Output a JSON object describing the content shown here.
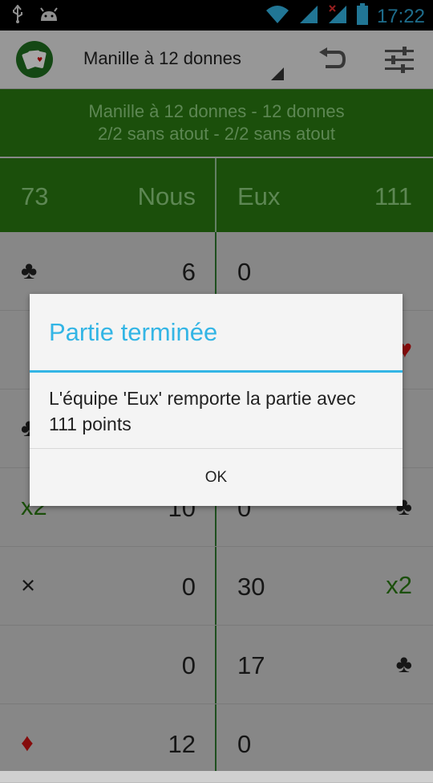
{
  "status_bar": {
    "time": "17:22"
  },
  "action_bar": {
    "game_selector": "Manille à 12 donnes"
  },
  "game_header": {
    "line1": "Manille à 12 donnes - 12 donnes",
    "line2": "2/2 sans atout - 2/2 sans atout"
  },
  "score_header": {
    "left_score": "73",
    "left_team": "Nous",
    "right_team": "Eux",
    "right_score": "111"
  },
  "rows": [
    {
      "left_symbol": "♣",
      "left_value": "6",
      "right_value": "0",
      "right_symbol": ""
    },
    {
      "left_symbol": "",
      "left_value": "",
      "right_value": "",
      "right_symbol": "♥"
    },
    {
      "left_symbol": "♣",
      "left_value": "",
      "right_value": "",
      "right_symbol": ""
    },
    {
      "left_symbol": "x2",
      "left_value": "10",
      "right_value": "0",
      "right_symbol": "♣"
    },
    {
      "left_symbol": "×",
      "left_value": "0",
      "right_value": "30",
      "right_symbol": "x2"
    },
    {
      "left_symbol": "",
      "left_value": "0",
      "right_value": "17",
      "right_symbol": "♣"
    },
    {
      "left_symbol": "♦",
      "left_value": "12",
      "right_value": "0",
      "right_symbol": ""
    }
  ],
  "dialog": {
    "title": "Partie terminée",
    "message": "L'équipe 'Eux' remporte la partie avec 111 points",
    "ok_label": "OK"
  },
  "colors": {
    "header_green": "#2a7a12",
    "accent_blue": "#33b5e5",
    "suit_red": "#cc1111"
  }
}
